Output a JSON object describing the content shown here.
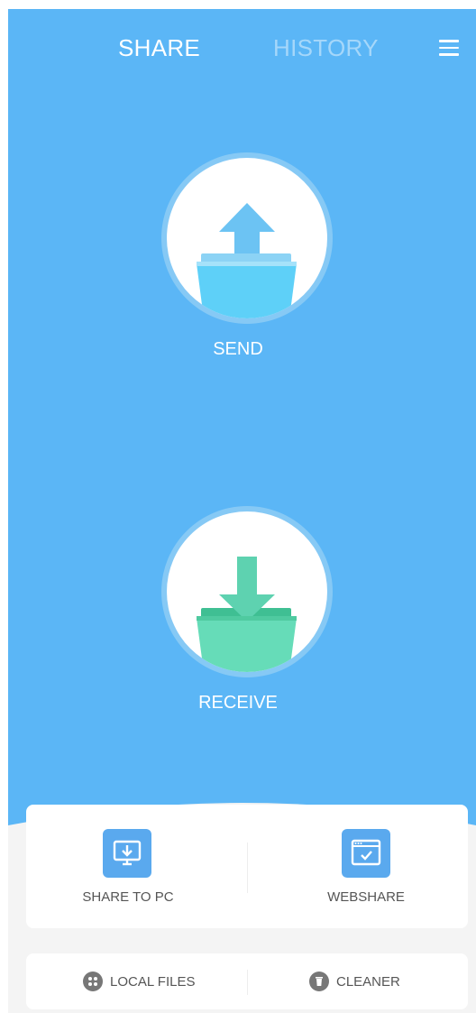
{
  "header": {
    "tab_share": "SHARE",
    "tab_history": "HISTORY",
    "menu_icon": "hamburger-menu-icon"
  },
  "main": {
    "send_label": "SEND",
    "receive_label": "RECEIVE",
    "send_icon": "upload-folder-icon",
    "receive_icon": "download-folder-icon"
  },
  "features": {
    "share_to_pc_label": "SHARE TO PC",
    "webshare_label": "WEBSHARE",
    "share_to_pc_icon": "monitor-download-icon",
    "webshare_icon": "browser-check-icon"
  },
  "tools": {
    "local_files_label": "LOCAL FILES",
    "cleaner_label": "CLEANER",
    "local_files_icon": "grid-dots-icon",
    "cleaner_icon": "trash-icon"
  },
  "colors": {
    "primary_blue": "#5bb6f6",
    "send_folder": "#5ec8ef",
    "receive_folder": "#5ed2b0",
    "feature_icon_bg": "#5aa9ee"
  }
}
